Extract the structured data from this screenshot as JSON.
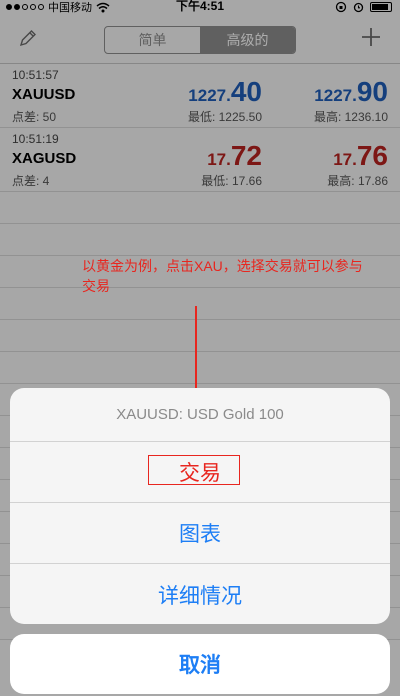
{
  "status_bar": {
    "carrier": "中国移动",
    "time": "下午4:51"
  },
  "nav": {
    "tabs": [
      "简单",
      "高级的"
    ],
    "active_tab": "高级的",
    "edit_icon": "pencil-icon",
    "add_icon": "plus-icon"
  },
  "quotes": [
    {
      "time": "10:51:57",
      "symbol": "XAUUSD",
      "spread": "点差: 50",
      "bid_prefix": "1227.",
      "bid_big": "40",
      "ask_prefix": "1227.",
      "ask_big": "90",
      "low": "最低: 1225.50",
      "high": "最高: 1236.10",
      "color": "#1f5eb8"
    },
    {
      "time": "10:51:19",
      "symbol": "XAGUSD",
      "spread": "点差: 4",
      "bid_prefix": "17.",
      "bid_big": "72",
      "ask_prefix": "17.",
      "ask_big": "76",
      "low": "最低: 17.66",
      "high": "最高: 17.86",
      "color": "#b8221f"
    }
  ],
  "annotation": {
    "text": "以黄金为例，点击XAU，选择交易就可以参与交易",
    "color": "#e8261f"
  },
  "action_sheet": {
    "title": "XAUUSD: USD Gold 100",
    "options": [
      "交易",
      "图表",
      "详细情况"
    ],
    "cancel": "取消"
  }
}
